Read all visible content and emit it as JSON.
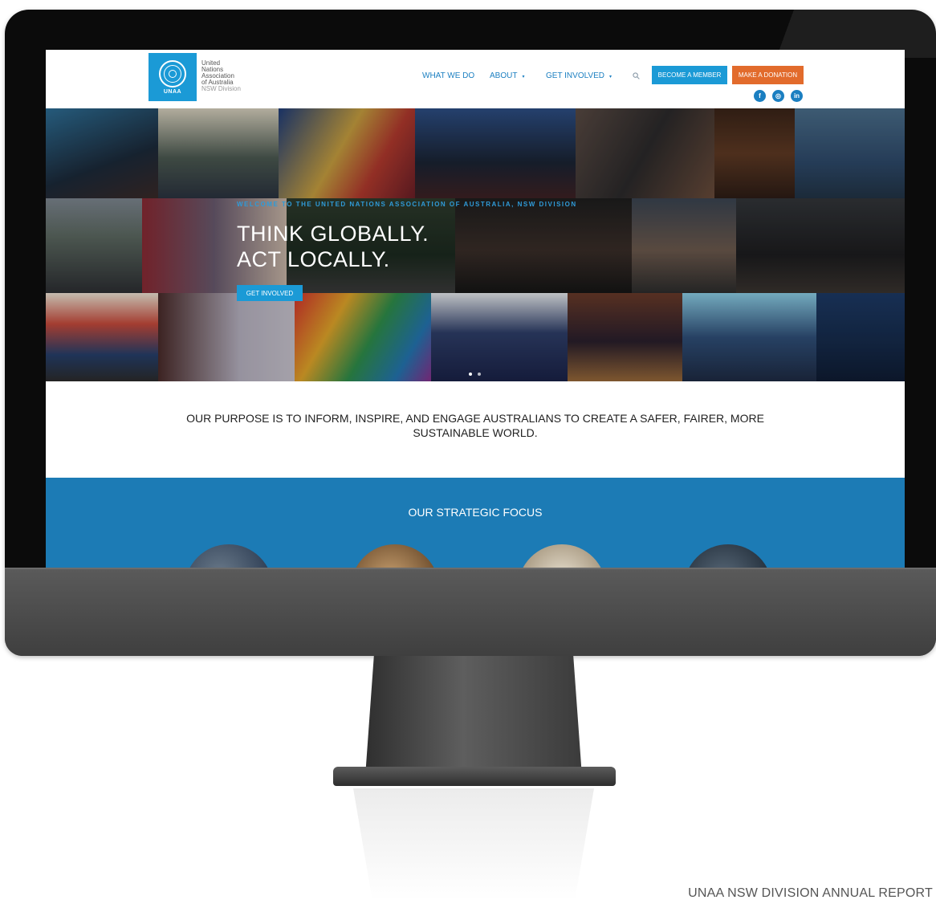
{
  "site": {
    "org_name": [
      "United",
      "Nations",
      "Association",
      "of Australia"
    ],
    "org_sub": "NSW Division",
    "logo_text": "UNAA"
  },
  "nav": {
    "items": [
      {
        "label": "WHAT WE DO"
      },
      {
        "label": "ABOUT"
      },
      {
        "label": "GET INVOLVED"
      }
    ],
    "caret": "▾"
  },
  "buttons": {
    "member": "BECOME A MEMBER",
    "donate": "MAKE A DONATION"
  },
  "social": [
    {
      "name": "facebook-icon",
      "glyph": "f"
    },
    {
      "name": "instagram-icon",
      "glyph": "◎"
    },
    {
      "name": "linkedin-icon",
      "glyph": "in"
    }
  ],
  "hero": {
    "eyebrow": "WELCOME TO THE UNITED NATIONS ASSOCIATION OF AUSTRALIA, NSW DIVISION",
    "headline_1": "THINK GLOBALLY.",
    "headline_2": "ACT LOCALLY.",
    "cta": "GET INVOLVED",
    "slides": 2,
    "active_slide": 1
  },
  "purpose": {
    "text": "OUR PURPOSE IS TO INFORM, INSPIRE, AND ENGAGE AUSTRALIANS TO CREATE A SAFER, FAIRER, MORE SUSTAINABLE WORLD."
  },
  "focus": {
    "title": "OUR STRATEGIC FOCUS"
  },
  "caption": "UNAA NSW DIVISION ANNUAL REPORT",
  "colors": {
    "brand_blue": "#1b9ad6",
    "link_blue": "#1b7fc1",
    "donate_orange": "#e26b2c",
    "focus_band": "#1c7bb5"
  }
}
